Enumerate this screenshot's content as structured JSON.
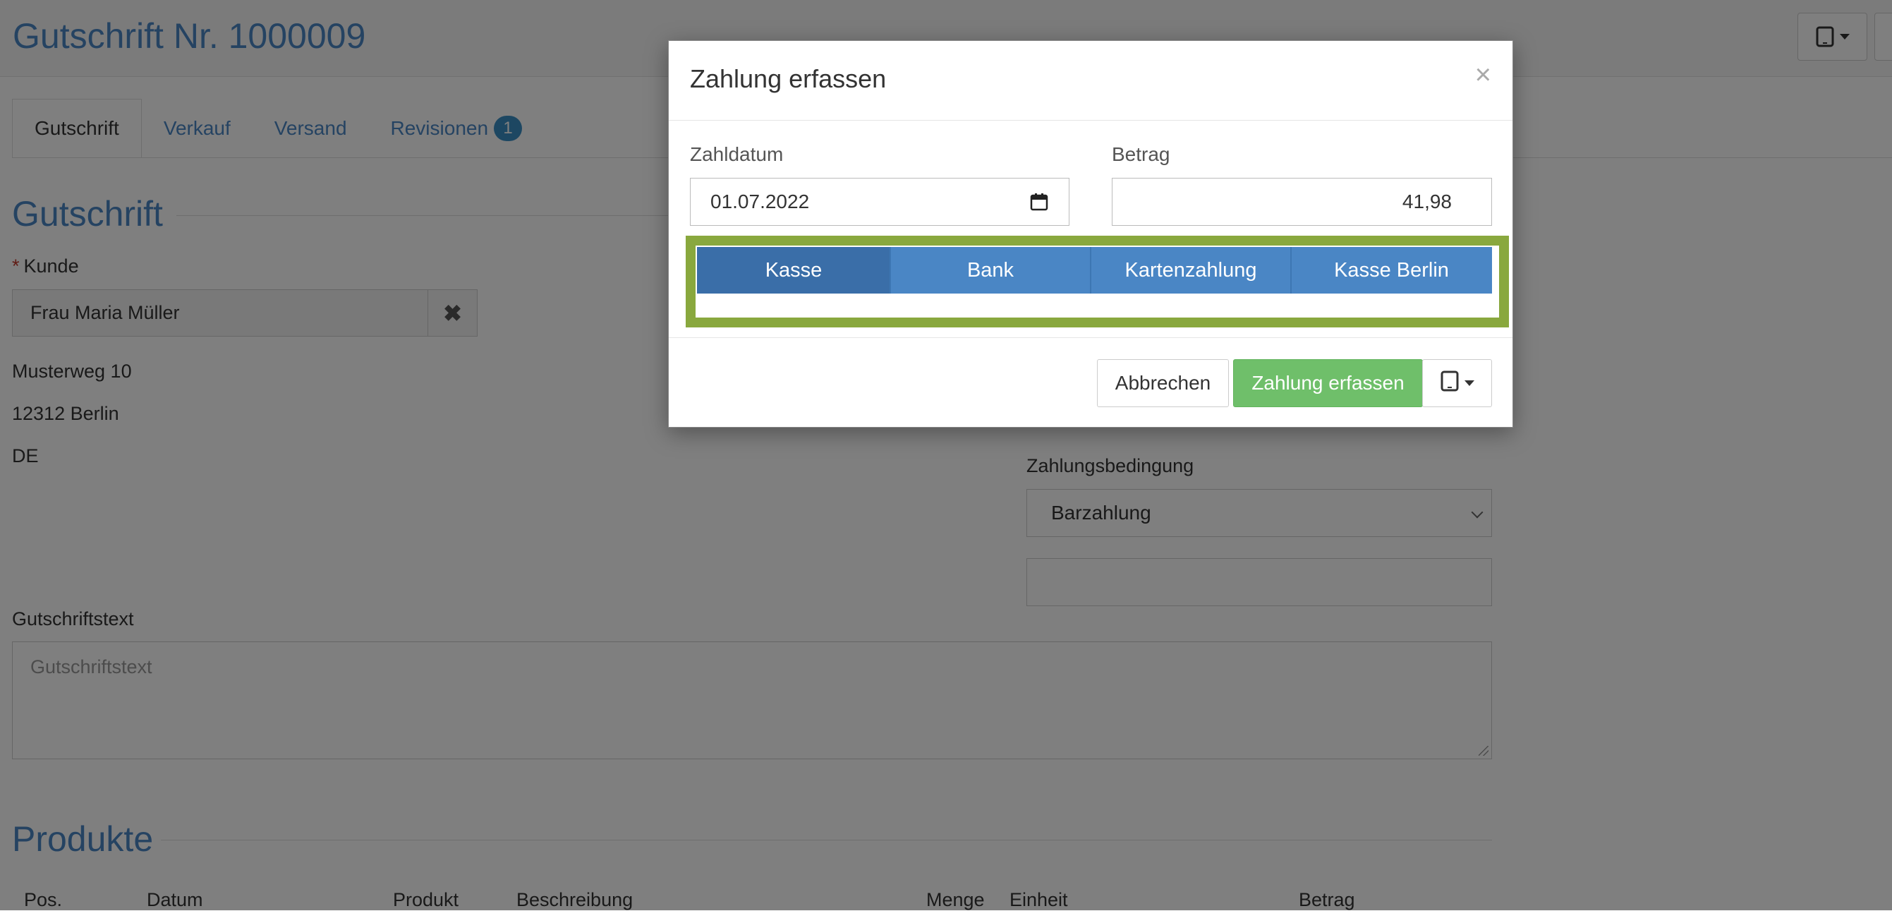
{
  "page": {
    "title": "Gutschrift Nr. 1000009"
  },
  "icons": {
    "tablet": "tablet-icon",
    "caret": "caret-down-icon",
    "close": "close-icon",
    "calendar": "calendar-icon",
    "clear": "clear-icon"
  },
  "tabs": [
    {
      "label": "Gutschrift",
      "active": true
    },
    {
      "label": "Verkauf"
    },
    {
      "label": "Versand"
    },
    {
      "label": "Revisionen",
      "badge": "1"
    }
  ],
  "form": {
    "section_title": "Gutschrift",
    "customer_label": "Kunde",
    "required_mark": "*",
    "customer_value": "Frau Maria Müller",
    "clear_symbol": "✖",
    "address": [
      "Musterweg 10",
      "12312 Berlin",
      "DE"
    ],
    "payment_terms_label": "Zahlungsbedingung",
    "payment_terms_value": "Barzahlung",
    "credit_text_label": "Gutschriftstext",
    "credit_text_placeholder": "Gutschriftstext"
  },
  "products": {
    "section_title": "Produkte",
    "columns": [
      "Pos.",
      "Datum",
      "Produkt",
      "Beschreibung",
      "Menge",
      "Einheit",
      "Betrag"
    ]
  },
  "modal": {
    "title": "Zahlung erfassen",
    "close_symbol": "×",
    "date_label": "Zahldatum",
    "date_value": "01.07.2022",
    "amount_label": "Betrag",
    "amount_value": "41,98",
    "accounts": [
      "Kasse",
      "Bank",
      "Kartenzahlung",
      "Kasse Berlin"
    ],
    "selected_account": "Kasse",
    "cancel_label": "Abbrechen",
    "submit_label": "Zahlung erfassen"
  },
  "colors": {
    "accent": "#4a86c5",
    "success": "#6fbf6a",
    "highlight": "#89a83e",
    "required": "#c0392b"
  }
}
